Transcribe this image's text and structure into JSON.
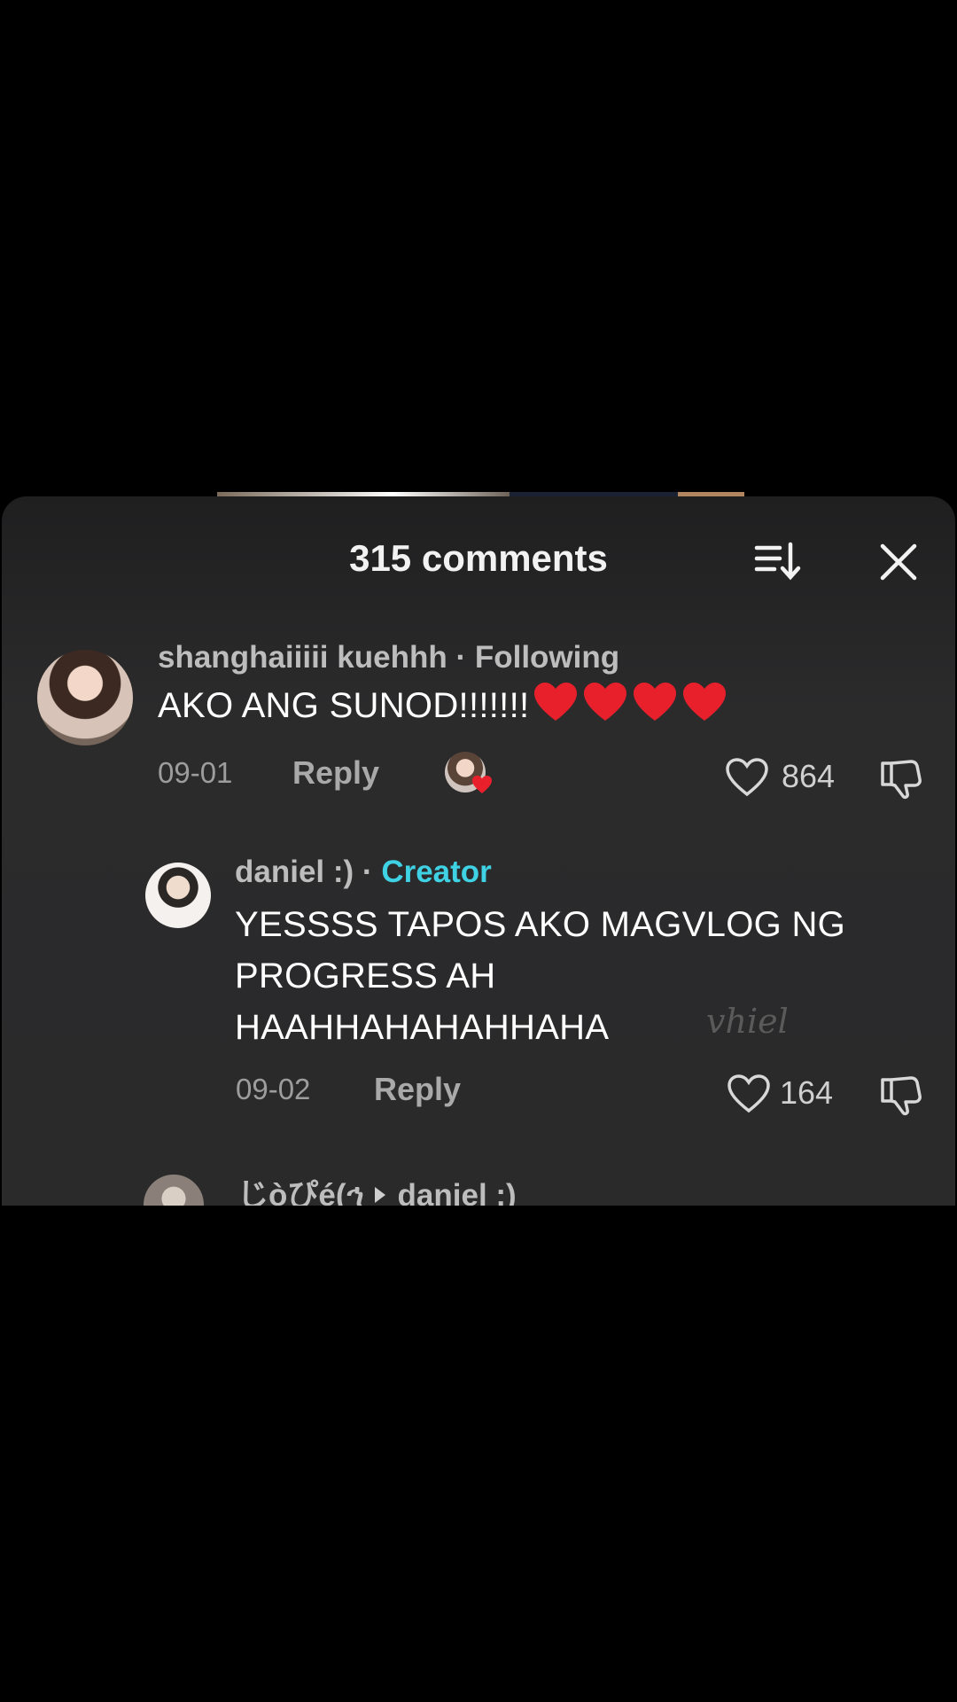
{
  "sheet": {
    "title": "315 comments"
  },
  "comments": [
    {
      "username": "shanghaiiiii kuehhh",
      "relation": "· Following",
      "text": "AKO ANG SUNOD!!!!!!!",
      "emoji_hearts": 4,
      "date": "09-01",
      "reply_label": "Reply",
      "likes": "864"
    },
    {
      "username": "daniel :)",
      "relation_sep": "·",
      "relation": "Creator",
      "text_lines": [
        "YESSSS TAPOS AKO MAGVLOG NG",
        "PROGRESS AH",
        "HAAHHAHAHAHHAHA"
      ],
      "date": "09-02",
      "reply_label": "Reply",
      "likes": "164"
    },
    {
      "username": "じòぴé(ኅ",
      "reply_to": "daniel :)"
    }
  ],
  "watermark": "vhiel",
  "colors": {
    "creator": "#3fd2e4",
    "heart": "#e8202c"
  }
}
